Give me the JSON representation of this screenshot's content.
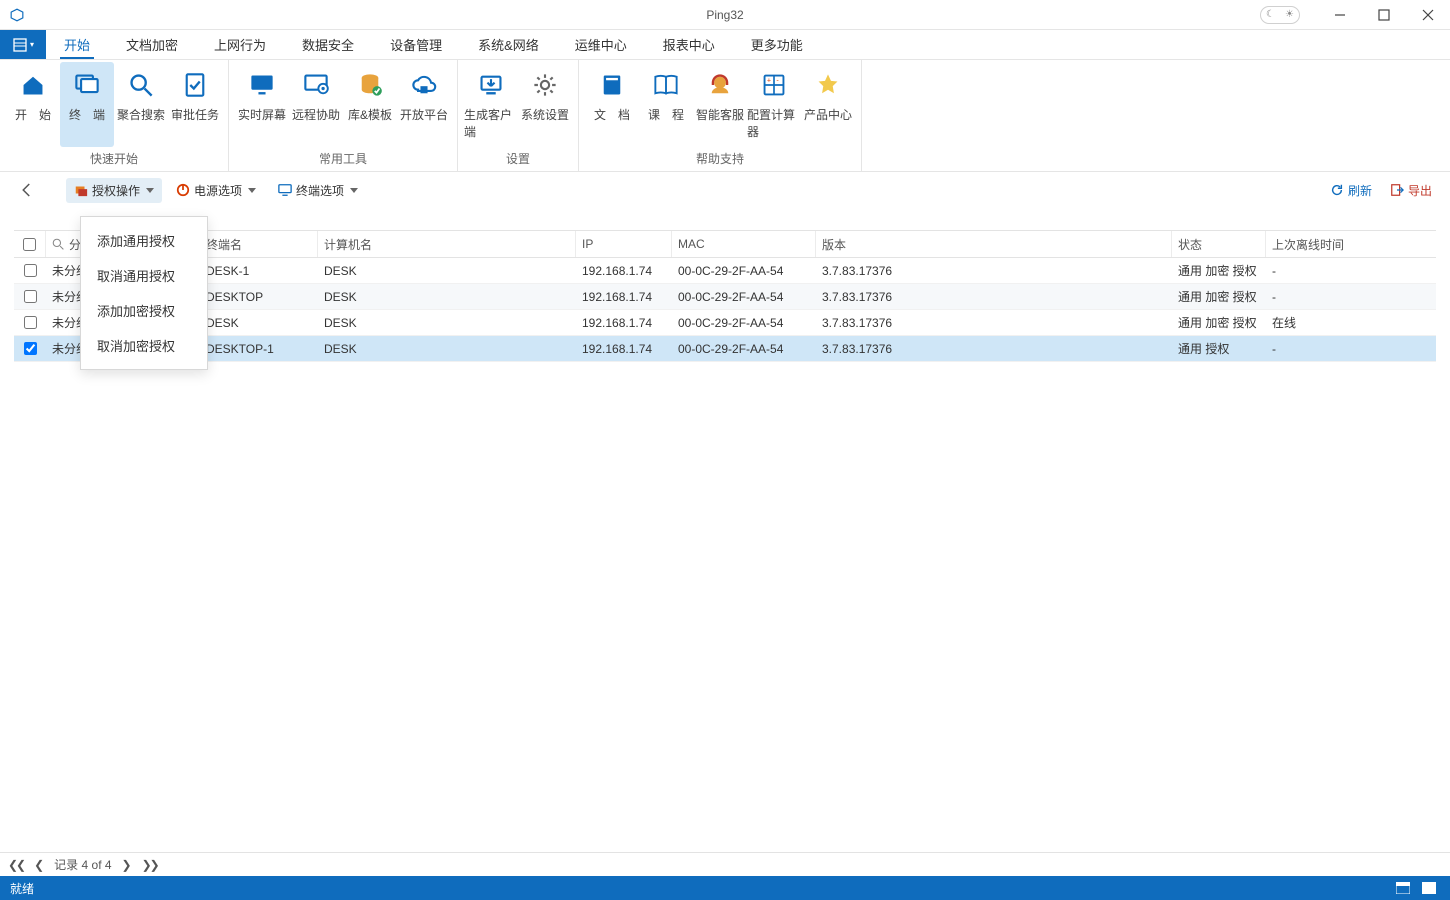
{
  "app": {
    "title": "Ping32"
  },
  "menu": {
    "tabs": [
      "开始",
      "文档加密",
      "上网行为",
      "数据安全",
      "设备管理",
      "系统&网络",
      "运维中心",
      "报表中心",
      "更多功能"
    ],
    "active_index": 0
  },
  "ribbon": {
    "groups": [
      {
        "label": "快速开始",
        "items": [
          {
            "label": "开　始",
            "icon": "home"
          },
          {
            "label": "终　端",
            "icon": "terminal",
            "selected": true
          },
          {
            "label": "聚合搜索",
            "icon": "search"
          },
          {
            "label": "审批任务",
            "icon": "approve"
          }
        ]
      },
      {
        "label": "常用工具",
        "items": [
          {
            "label": "实时屏幕",
            "icon": "monitor"
          },
          {
            "label": "远程协助",
            "icon": "remote"
          },
          {
            "label": "库&模板",
            "icon": "database"
          },
          {
            "label": "开放平台",
            "icon": "cloud"
          }
        ]
      },
      {
        "label": "设置",
        "items": [
          {
            "label": "生成客户端",
            "icon": "download"
          },
          {
            "label": "系统设置",
            "icon": "gear"
          }
        ]
      },
      {
        "label": "帮助支持",
        "items": [
          {
            "label": "文　档",
            "icon": "book"
          },
          {
            "label": "课　程",
            "icon": "openbook"
          },
          {
            "label": "智能客服",
            "icon": "support"
          },
          {
            "label": "配置计算器",
            "icon": "calc"
          },
          {
            "label": "产品中心",
            "icon": "star"
          }
        ]
      }
    ]
  },
  "actionbar": {
    "auth_ops": "授权操作",
    "power_opts": "电源选项",
    "terminal_opts": "终端选项",
    "refresh": "刷新",
    "export": "导出"
  },
  "dropdown": {
    "items": [
      "添加通用授权",
      "取消通用授权",
      "添加加密授权",
      "取消加密授权"
    ]
  },
  "table": {
    "headers": {
      "group": "分组",
      "terminal": "终端名",
      "computer": "计算机名",
      "ip": "IP",
      "mac": "MAC",
      "version": "版本",
      "status": "状态",
      "last_offline": "上次离线时间"
    },
    "search_icon": "search",
    "rows": [
      {
        "checked": false,
        "group": "未分组",
        "terminal": "DESK-1",
        "computer": "DESK",
        "ip": "192.168.1.74",
        "mac": "00-0C-29-2F-AA-54",
        "version": "3.7.83.17376",
        "status": "通用 加密 授权",
        "last": "-"
      },
      {
        "checked": false,
        "group": "未分组",
        "terminal": "DESKTOP",
        "computer": "DESK",
        "ip": "192.168.1.74",
        "mac": "00-0C-29-2F-AA-54",
        "version": "3.7.83.17376",
        "status": "通用 加密 授权",
        "last": "-"
      },
      {
        "checked": false,
        "group": "未分组",
        "terminal": "DESK",
        "computer": "DESK",
        "ip": "192.168.1.74",
        "mac": "00-0C-29-2F-AA-54",
        "version": "3.7.83.17376",
        "status": "通用 加密 授权",
        "last": "在线"
      },
      {
        "checked": true,
        "group": "未分组",
        "terminal": "DESKTOP-1",
        "computer": "DESK",
        "ip": "192.168.1.74",
        "mac": "00-0C-29-2F-AA-54",
        "version": "3.7.83.17376",
        "status": "通用 授权",
        "last": "-"
      }
    ]
  },
  "paging": {
    "label": "记录 4 of 4"
  },
  "status": {
    "text": "就绪"
  }
}
